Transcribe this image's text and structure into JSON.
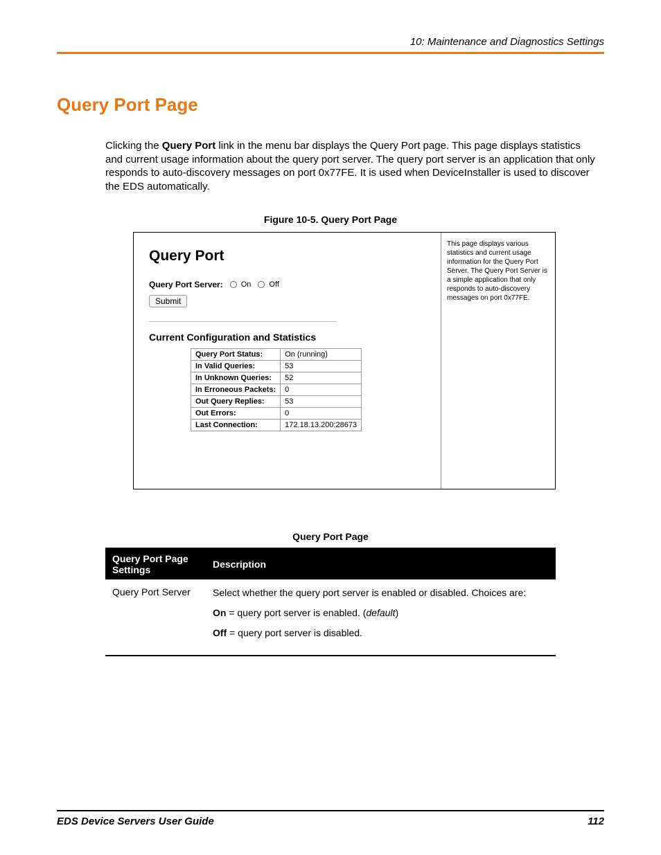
{
  "chapter_header": "10: Maintenance and Diagnostics Settings",
  "section_heading": "Query Port Page",
  "intro": {
    "t1": "Clicking the ",
    "bold1": "Query Port",
    "t2": " link in the menu bar displays the Query Port page. This page displays statistics and current usage information about the query port server. The query port server is an application that only responds to auto-discovery messages on port 0x77FE. It is used when DeviceInstaller is used to discover the EDS automatically."
  },
  "figure": {
    "caption": "Figure 10-5. Query Port Page",
    "title": "Query Port",
    "server_label": "Query Port Server:",
    "radio_on": "On",
    "radio_off": "Off",
    "submit": "Submit",
    "subheading": "Current Configuration and Statistics",
    "rows": [
      {
        "k": "Query Port Status:",
        "v": "On (running)"
      },
      {
        "k": "In Valid Queries:",
        "v": "53"
      },
      {
        "k": "In Unknown Queries:",
        "v": "52"
      },
      {
        "k": "In Erroneous Packets:",
        "v": "0"
      },
      {
        "k": "Out Query Replies:",
        "v": "53"
      },
      {
        "k": "Out Errors:",
        "v": "0"
      },
      {
        "k": "Last Connection:",
        "v": "172.18.13.200:28673"
      }
    ],
    "side_text": "This page displays various statistics and current usage information for the Query Port Server. The Query Port Server is a simple application that only responds to auto-discovery messages on port 0x77FE."
  },
  "settings": {
    "caption": "Query Port Page",
    "col1": "Query Port Page Settings",
    "col2": "Description",
    "row_label": "Query Port Server",
    "desc_intro": "Select whether the query port server is enabled or disabled. Choices are:",
    "desc_on_k": "On",
    "desc_on_t": " = query port server is enabled. (",
    "desc_on_i": "default",
    "desc_on_end": ")",
    "desc_off_k": "Off",
    "desc_off_t": " = query port server is disabled."
  },
  "footer": {
    "left": "EDS Device Servers User Guide",
    "right": "112"
  }
}
